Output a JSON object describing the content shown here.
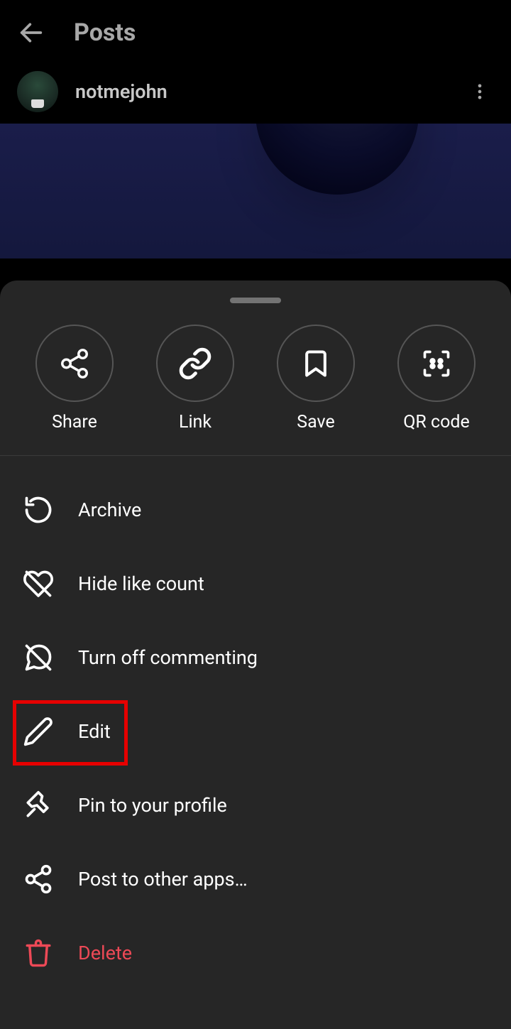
{
  "header": {
    "title": "Posts"
  },
  "post": {
    "username": "notmejohn"
  },
  "sheet": {
    "actions": [
      {
        "label": "Share",
        "icon": "share-icon"
      },
      {
        "label": "Link",
        "icon": "link-icon"
      },
      {
        "label": "Save",
        "icon": "save-icon"
      },
      {
        "label": "QR code",
        "icon": "qr-icon"
      }
    ],
    "menu": [
      {
        "label": "Archive",
        "icon": "archive-icon"
      },
      {
        "label": "Hide like count",
        "icon": "heart-off-icon"
      },
      {
        "label": "Turn off commenting",
        "icon": "comment-off-icon"
      },
      {
        "label": "Edit",
        "icon": "pencil-icon",
        "highlighted": true
      },
      {
        "label": "Pin to your profile",
        "icon": "pin-icon"
      },
      {
        "label": "Post to other apps…",
        "icon": "share-alt-icon"
      },
      {
        "label": "Delete",
        "icon": "trash-icon",
        "danger": true
      }
    ]
  }
}
